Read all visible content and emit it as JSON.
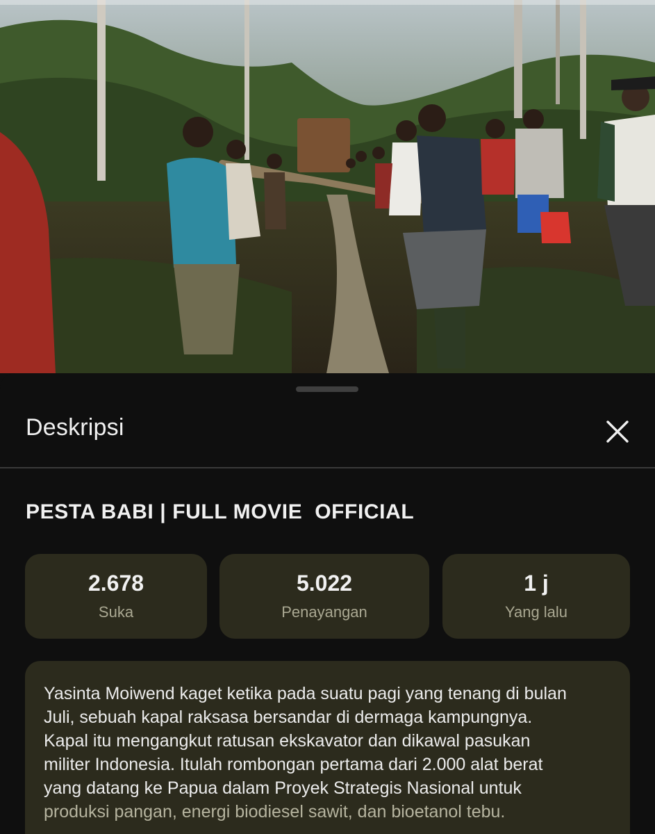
{
  "player": {
    "progress_fraction": 0.0,
    "scene_description_icon": "video-thumbnail"
  },
  "sheet": {
    "title": "Deskripsi",
    "close_icon": "close-icon"
  },
  "video": {
    "title": "PESTA BABI | FULL MOVIE  OFFICIAL"
  },
  "stats": {
    "likes": {
      "value": "2.678",
      "label": "Suka"
    },
    "views": {
      "value": "5.022",
      "label": "Penayangan"
    },
    "age": {
      "value": "1 j",
      "label": "Yang lalu"
    }
  },
  "description": {
    "lines": [
      "Yasinta Moiwend kaget ketika pada suatu pagi yang tenang di bulan",
      "Juli, sebuah kapal raksasa bersandar di dermaga kampungnya.",
      "Kapal itu mengangkut ratusan ekskavator dan dikawal pasukan",
      "militer Indonesia. Itulah rombongan pertama dari 2.000 alat berat",
      "yang datang ke Papua dalam Proyek Strategis Nasional untuk",
      "produksi pangan, energi biodiesel sawit, dan bioetanol tebu."
    ]
  },
  "colors": {
    "background": "#0f0f0f",
    "card": "#2c2b1d",
    "text_primary": "#f1f1f1",
    "text_secondary": "#aaa892",
    "progress": "#ff0000"
  }
}
